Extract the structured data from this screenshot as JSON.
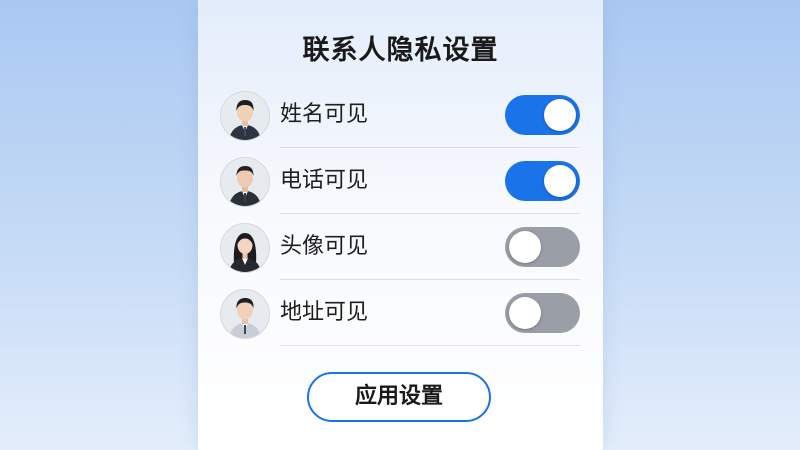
{
  "title": "联系人隐私设置",
  "settings": [
    {
      "label": "姓名可见",
      "enabled": true,
      "avatar": "male-avatar-suit"
    },
    {
      "label": "电话可见",
      "enabled": true,
      "avatar": "male-avatar-suit"
    },
    {
      "label": "头像可见",
      "enabled": false,
      "avatar": "female-avatar-suit"
    },
    {
      "label": "地址可见",
      "enabled": false,
      "avatar": "male-avatar-light-suit"
    }
  ],
  "apply_button": {
    "label": "应用设置"
  },
  "colors": {
    "accent": "#1a73e8",
    "toggle_off": "#9a9ea6",
    "text": "#1a1a1a"
  }
}
